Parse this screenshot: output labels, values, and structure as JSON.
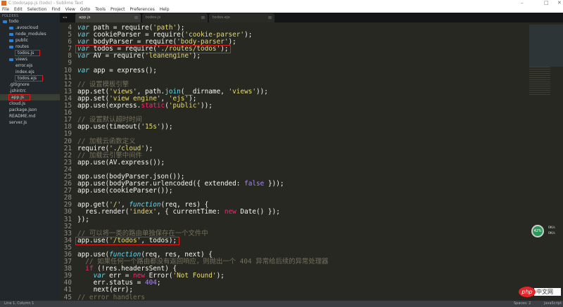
{
  "window": {
    "title": "C:\\todo\\app.js (todo) - Sublime Text",
    "minimize": "–",
    "maximize": "□",
    "close": "✕"
  },
  "menu": [
    "File",
    "Edit",
    "Selection",
    "Find",
    "View",
    "Goto",
    "Tools",
    "Project",
    "Preferences",
    "Help"
  ],
  "sidebar": {
    "header": "FOLDERS",
    "items": [
      {
        "label": "todo",
        "type": "folder",
        "depth": 0
      },
      {
        "label": ".avoscloud",
        "type": "folder",
        "depth": 1
      },
      {
        "label": "node_modules",
        "type": "folder",
        "depth": 1
      },
      {
        "label": "public",
        "type": "folder",
        "depth": 1
      },
      {
        "label": "routes",
        "type": "folder",
        "depth": 1
      },
      {
        "label": "todos.js",
        "type": "file",
        "depth": 2,
        "highlight": true
      },
      {
        "label": "views",
        "type": "folder",
        "depth": 1
      },
      {
        "label": "error.ejs",
        "type": "file",
        "depth": 2
      },
      {
        "label": "index.ejs",
        "type": "file",
        "depth": 2
      },
      {
        "label": "todos.ejs",
        "type": "file",
        "depth": 2,
        "highlight": true
      },
      {
        "label": ".gitignore",
        "type": "file",
        "depth": 1
      },
      {
        "label": ".jshintrc",
        "type": "file",
        "depth": 1
      },
      {
        "label": "app.js",
        "type": "file",
        "depth": 1,
        "highlight": true,
        "selected": true
      },
      {
        "label": "cloud.js",
        "type": "file",
        "depth": 1
      },
      {
        "label": "package.json",
        "type": "file",
        "depth": 1
      },
      {
        "label": "README.md",
        "type": "file",
        "depth": 1
      },
      {
        "label": "server.js",
        "type": "file",
        "depth": 1
      }
    ]
  },
  "tabs": [
    {
      "label": "app.js",
      "active": true
    },
    {
      "label": "todos.js"
    },
    {
      "label": "todos.ejs"
    }
  ],
  "tab_nav": "◂ ▸",
  "tab_close": "⊠",
  "code": [
    {
      "n": "4",
      "t": [
        [
          "var",
          "kw"
        ],
        [
          " path = require("
        ],
        [
          "'path'",
          "str"
        ],
        [
          ");"
        ]
      ]
    },
    {
      "n": "5",
      "t": [
        [
          "var",
          "kw"
        ],
        [
          " cookieParser = require("
        ],
        [
          "'cookie-parser'",
          "str"
        ],
        [
          ");"
        ]
      ]
    },
    {
      "n": "6",
      "t": [
        [
          "var",
          "kw"
        ],
        [
          " bodyParser = require("
        ],
        [
          "'body-parser'",
          "str"
        ],
        [
          ");"
        ]
      ]
    },
    {
      "n": "7",
      "box": true,
      "t": [
        [
          "var",
          "kw"
        ],
        [
          " todos = require("
        ],
        [
          "'./routes/todos'",
          "str"
        ],
        [
          ");"
        ]
      ]
    },
    {
      "n": "8",
      "t": [
        [
          "var",
          "kw"
        ],
        [
          " AV = require("
        ],
        [
          "'leanengine'",
          "str"
        ],
        [
          ");"
        ]
      ]
    },
    {
      "n": "9",
      "t": []
    },
    {
      "n": "10",
      "t": [
        [
          "var",
          "kw"
        ],
        [
          " app = express();"
        ]
      ]
    },
    {
      "n": "11",
      "t": []
    },
    {
      "n": "12",
      "t": [
        [
          "// 设置模板引擎",
          "cm"
        ]
      ]
    },
    {
      "n": "13",
      "t": [
        [
          "app.set("
        ],
        [
          "'views'",
          "str"
        ],
        [
          ", path."
        ],
        [
          "join",
          "fn"
        ],
        [
          "(__dirname, "
        ],
        [
          "'views'",
          "str"
        ],
        [
          "));"
        ]
      ]
    },
    {
      "n": "14",
      "t": [
        [
          "app.set("
        ],
        [
          "'view engine'",
          "str"
        ],
        [
          ", "
        ],
        [
          "'ejs'",
          "str"
        ],
        [
          ");"
        ]
      ]
    },
    {
      "n": "15",
      "t": [
        [
          "app.use(express."
        ],
        [
          "static",
          "red"
        ],
        [
          "("
        ],
        [
          "'public'",
          "str"
        ],
        [
          "));"
        ]
      ]
    },
    {
      "n": "16",
      "t": []
    },
    {
      "n": "17",
      "t": [
        [
          "// 设置默认超时时间",
          "cm"
        ]
      ]
    },
    {
      "n": "18",
      "t": [
        [
          "app.use(timeout("
        ],
        [
          "'15s'",
          "str"
        ],
        [
          "));"
        ]
      ]
    },
    {
      "n": "19",
      "t": []
    },
    {
      "n": "20",
      "t": [
        [
          "// 加载云函数定义",
          "cm"
        ]
      ]
    },
    {
      "n": "21",
      "t": [
        [
          "require("
        ],
        [
          "'./cloud'",
          "str"
        ],
        [
          ");"
        ]
      ]
    },
    {
      "n": "22",
      "t": [
        [
          "// 加载云引擎中间件",
          "cm"
        ]
      ]
    },
    {
      "n": "23",
      "t": [
        [
          "app.use(AV.express());"
        ]
      ]
    },
    {
      "n": "24",
      "t": []
    },
    {
      "n": "25",
      "t": [
        [
          "app.use(bodyParser.json());"
        ]
      ]
    },
    {
      "n": "26",
      "t": [
        [
          "app.use(bodyParser.urlencoded({ extended: "
        ],
        [
          "false",
          "num"
        ],
        [
          " }));"
        ]
      ]
    },
    {
      "n": "27",
      "t": [
        [
          "app.use(cookieParser());"
        ]
      ]
    },
    {
      "n": "28",
      "t": []
    },
    {
      "n": "29",
      "t": [
        [
          "app.get("
        ],
        [
          "'/'",
          "str"
        ],
        [
          ", "
        ],
        [
          "function",
          "fnit"
        ],
        [
          "(req, res) {"
        ]
      ]
    },
    {
      "n": "30",
      "t": [
        [
          "  res.render("
        ],
        [
          "'index'",
          "str"
        ],
        [
          ", { currentTime: "
        ],
        [
          "new",
          "red"
        ],
        [
          " Date() });"
        ]
      ]
    },
    {
      "n": "31",
      "t": [
        [
          "});"
        ]
      ]
    },
    {
      "n": "32",
      "t": []
    },
    {
      "n": "33",
      "t": [
        [
          "// 可以将一类的路由单独保存在一个文件中",
          "cm"
        ]
      ]
    },
    {
      "n": "34",
      "box": true,
      "t": [
        [
          "app.use("
        ],
        [
          "'/todos'",
          "str"
        ],
        [
          ", todos);"
        ]
      ]
    },
    {
      "n": "35",
      "t": []
    },
    {
      "n": "36",
      "t": [
        [
          "app.use("
        ],
        [
          "function",
          "fnit"
        ],
        [
          "(req, res, next) {"
        ]
      ]
    },
    {
      "n": "37",
      "t": [
        [
          "  // 如果任何一个路由都没有返回响应，则抛出一个 404 异常给后续的异常处理器",
          "cm"
        ]
      ]
    },
    {
      "n": "38",
      "t": [
        [
          "  "
        ],
        [
          "if",
          "red"
        ],
        [
          " (!res.headersSent) {"
        ]
      ]
    },
    {
      "n": "39",
      "t": [
        [
          "    "
        ],
        [
          "var",
          "kw"
        ],
        [
          " err = "
        ],
        [
          "new",
          "red"
        ],
        [
          " Error("
        ],
        [
          "'Not Found'",
          "str"
        ],
        [
          ");"
        ]
      ]
    },
    {
      "n": "40",
      "t": [
        [
          "    err.status = "
        ],
        [
          "404",
          "num"
        ],
        [
          ";"
        ]
      ]
    },
    {
      "n": "41",
      "t": [
        [
          "    next(err);"
        ]
      ]
    },
    {
      "n": "45",
      "t": [
        [
          "// error handlers",
          "cm"
        ]
      ]
    }
  ],
  "widget": {
    "percent": "42%",
    "up": "0K/s",
    "down": "0K/s"
  },
  "watermark": {
    "logo": "php",
    "text": "中文网"
  },
  "status": {
    "position": "Line 1, Column 1",
    "indent": "Spaces: 2",
    "syntax": "JavaScript"
  },
  "colors": {
    "background": "#272822",
    "sidebar": "#22272c",
    "highlight_box": "#e01b1b"
  }
}
